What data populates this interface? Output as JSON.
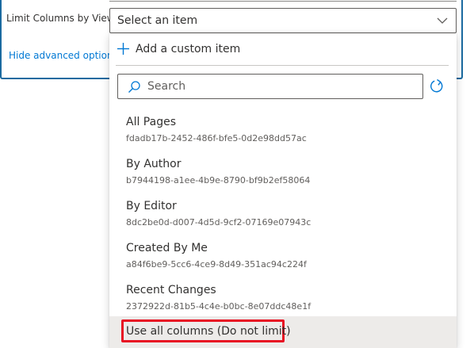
{
  "form": {
    "field_label": "Limit Columns by View",
    "advanced_link": "Hide advanced options"
  },
  "select": {
    "value": "Select an item",
    "chevron_icon": "chevron-down-icon"
  },
  "dropdown": {
    "add_custom_item": "Add a custom item",
    "search_placeholder": "Search",
    "items": [
      {
        "title": "All Pages",
        "id": "fdadb17b-2452-486f-bfe5-0d2e98dd57ac"
      },
      {
        "title": "By Author",
        "id": "b7944198-a1ee-4b9e-8790-bf9b2ef58064"
      },
      {
        "title": "By Editor",
        "id": "8dc2be0d-d007-4d5d-9cf2-07169e07943c"
      },
      {
        "title": "Created By Me",
        "id": "a84f6be9-5cc6-4ce9-8d49-351ac94c224f"
      },
      {
        "title": "Recent Changes",
        "id": "2372922d-81b5-4c4e-b0bc-8e07ddc48e1f"
      }
    ],
    "no_limit_option": "Use all columns (Do not limit)"
  },
  "colors": {
    "accent": "#0078d4",
    "highlight_border": "#e81123",
    "hover_background": "#edebe9"
  }
}
